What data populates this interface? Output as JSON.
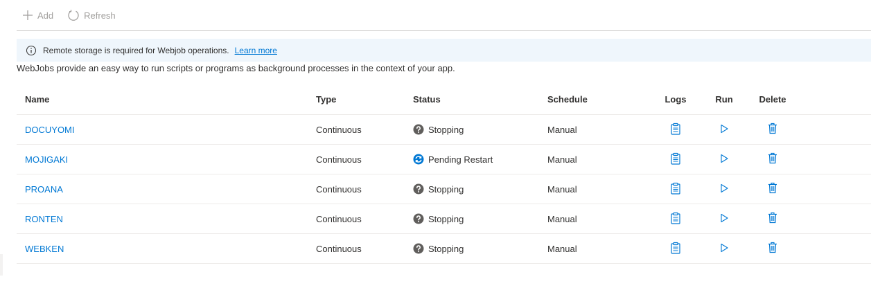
{
  "toolbar": {
    "add_label": "Add",
    "refresh_label": "Refresh"
  },
  "banner": {
    "message": "Remote storage is required for Webjob operations.",
    "link": "Learn more"
  },
  "description": "WebJobs provide an easy way to run scripts or programs as background processes in the context of your app.",
  "table": {
    "headers": {
      "name": "Name",
      "type": "Type",
      "status": "Status",
      "schedule": "Schedule",
      "logs": "Logs",
      "run": "Run",
      "delete": "Delete"
    },
    "rows": [
      {
        "name": "DOCUYOMI",
        "type": "Continuous",
        "status": "Stopping",
        "status_icon": "question-icon",
        "schedule": "Manual"
      },
      {
        "name": "MOJIGAKI",
        "type": "Continuous",
        "status": "Pending Restart",
        "status_icon": "sync-icon",
        "schedule": "Manual"
      },
      {
        "name": "PROANA",
        "type": "Continuous",
        "status": "Stopping",
        "status_icon": "question-icon",
        "schedule": "Manual"
      },
      {
        "name": "RONTEN",
        "type": "Continuous",
        "status": "Stopping",
        "status_icon": "question-icon",
        "schedule": "Manual"
      },
      {
        "name": "WEBKEN",
        "type": "Continuous",
        "status": "Stopping",
        "status_icon": "question-icon",
        "schedule": "Manual"
      }
    ]
  },
  "colors": {
    "accent": "#0078d4",
    "status_unknown": "#605e5c",
    "banner_bg": "#eff6fc",
    "disabled": "#a19f9d"
  }
}
